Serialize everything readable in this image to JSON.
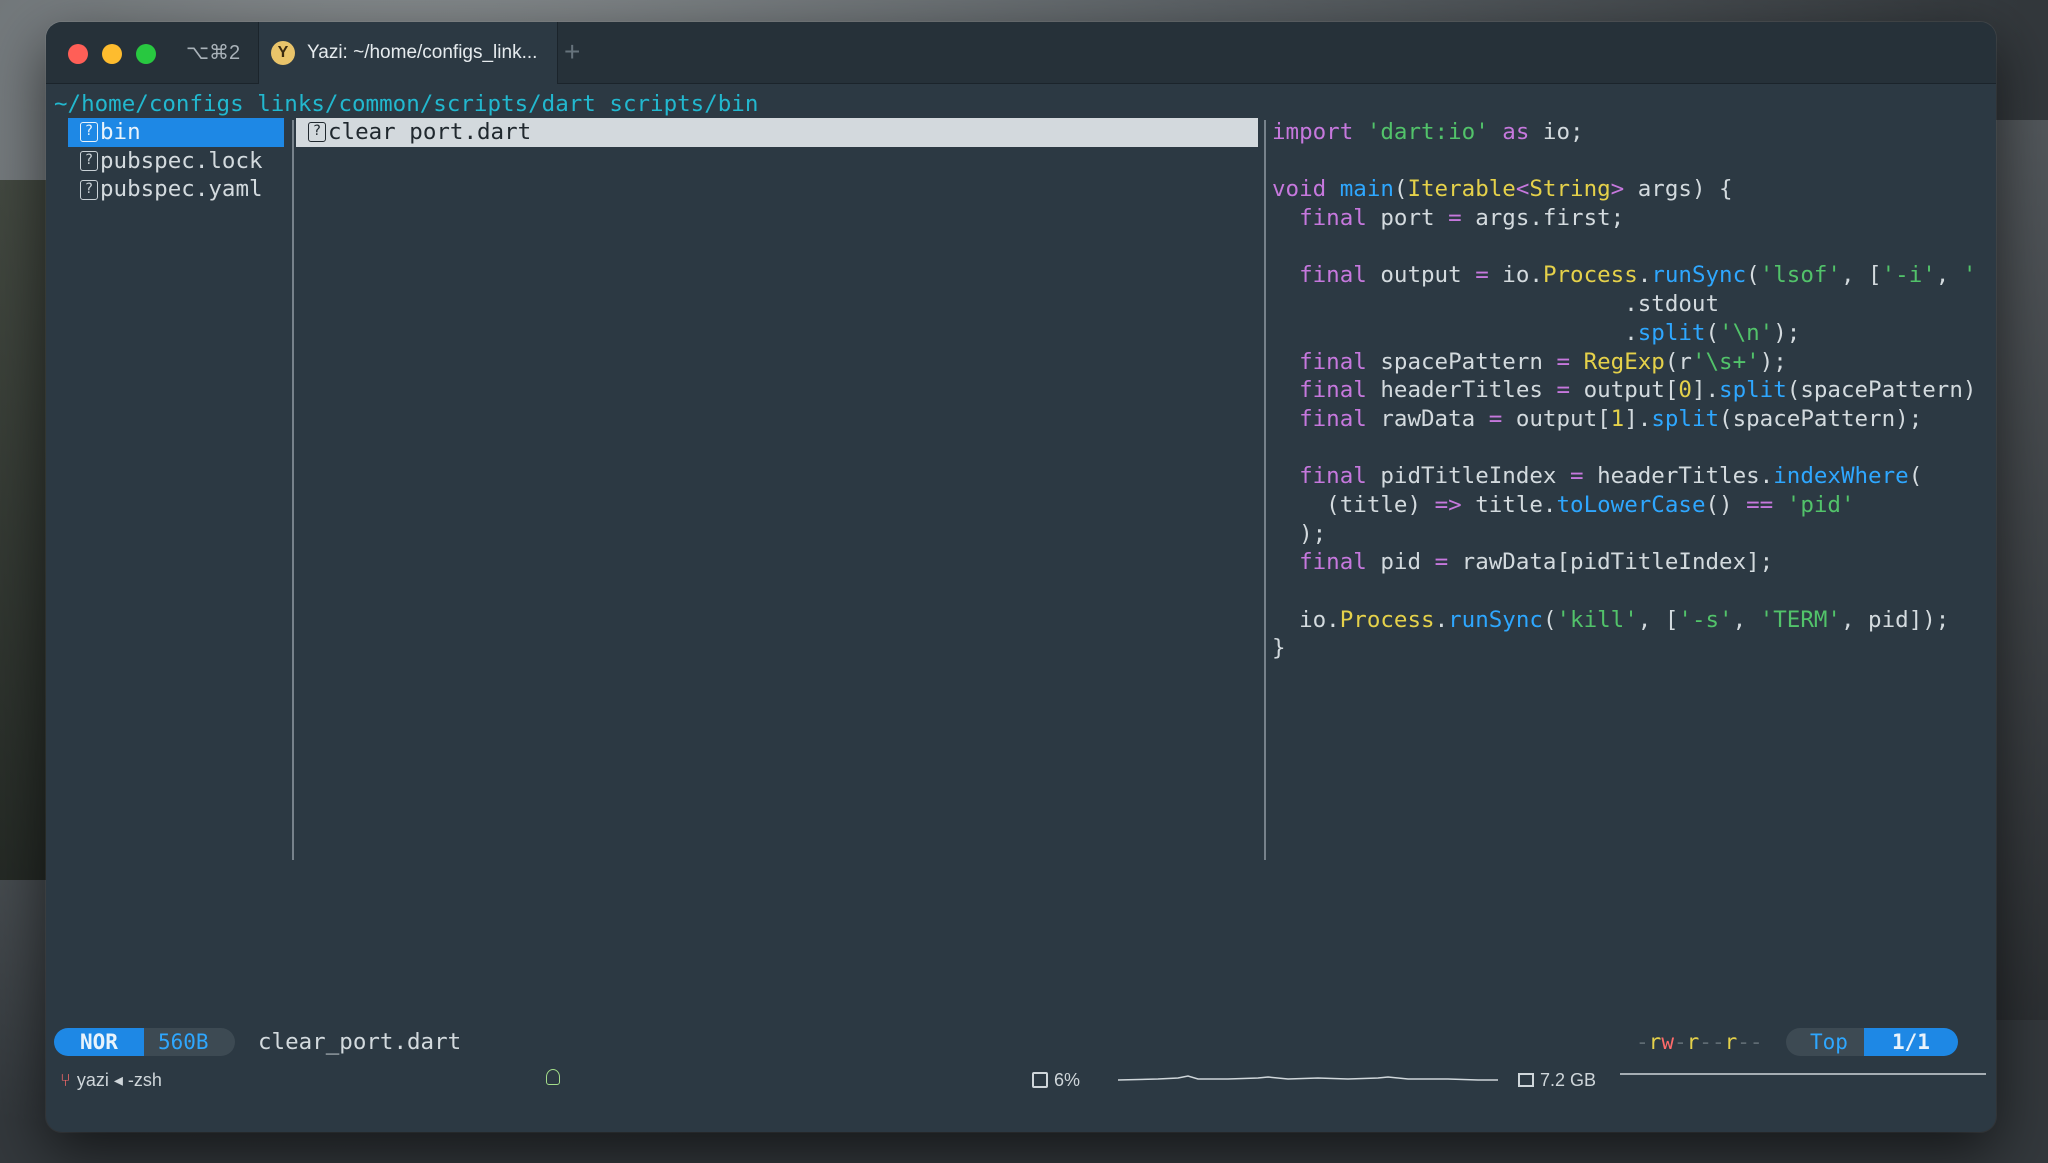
{
  "titlebar": {
    "shortcut": "⌥⌘2",
    "tab_icon_letter": "Y",
    "tab_title": "Yazi: ~/home/configs_link...",
    "new_tab": "+"
  },
  "cwd": "~/home/configs links/common/scripts/dart scripts/bin",
  "parent_pane": {
    "items": [
      "bin",
      "pubspec.lock",
      "pubspec.yaml"
    ],
    "selected": "bin"
  },
  "current_pane": {
    "items": [
      "clear port.dart"
    ]
  },
  "preview_lines": [
    "import 'dart:io' as io;",
    "",
    "void main(Iterable<String> args) {",
    "  final port = args.first;",
    "",
    "  final output = io.Process.runSync('lsof', ['-i', '",
    "                          .stdout",
    "                          .split('\\n');",
    "  final spacePattern = RegExp(r'\\s+');",
    "  final headerTitles = output[0].split(spacePattern)",
    "  final rawData = output[1].split(spacePattern);",
    "",
    "  final pidTitleIndex = headerTitles.indexWhere(",
    "    (title) => title.toLowerCase() == 'pid'",
    "  );",
    "  final pid = rawData[pidTitleIndex];",
    "",
    "  io.Process.runSync('kill', ['-s', 'TERM', pid]);",
    "}"
  ],
  "status": {
    "mode": "NOR",
    "size": "560B",
    "filename": "clear_port.dart",
    "permissions": "-rw-r--r--",
    "position": "Top",
    "count": "1/1"
  },
  "bottombar": {
    "session": "yazi ◂ -zsh",
    "cpu": "6%",
    "memory": "7.2 GB"
  },
  "colors": {
    "accent_blue": "#1e88e5",
    "path_cyan": "#22b8cf",
    "keyword_purple": "#c678dd",
    "function_blue": "#2ea7ff",
    "type_yellow": "#e5d14a",
    "string_green": "#52c36a"
  },
  "icons": [
    "close-traffic-light",
    "minimize-traffic-light",
    "maximize-traffic-light",
    "yazi-icon",
    "unknown-file-icon",
    "git-branch-icon",
    "user-icon",
    "cpu-icon",
    "memory-icon"
  ]
}
